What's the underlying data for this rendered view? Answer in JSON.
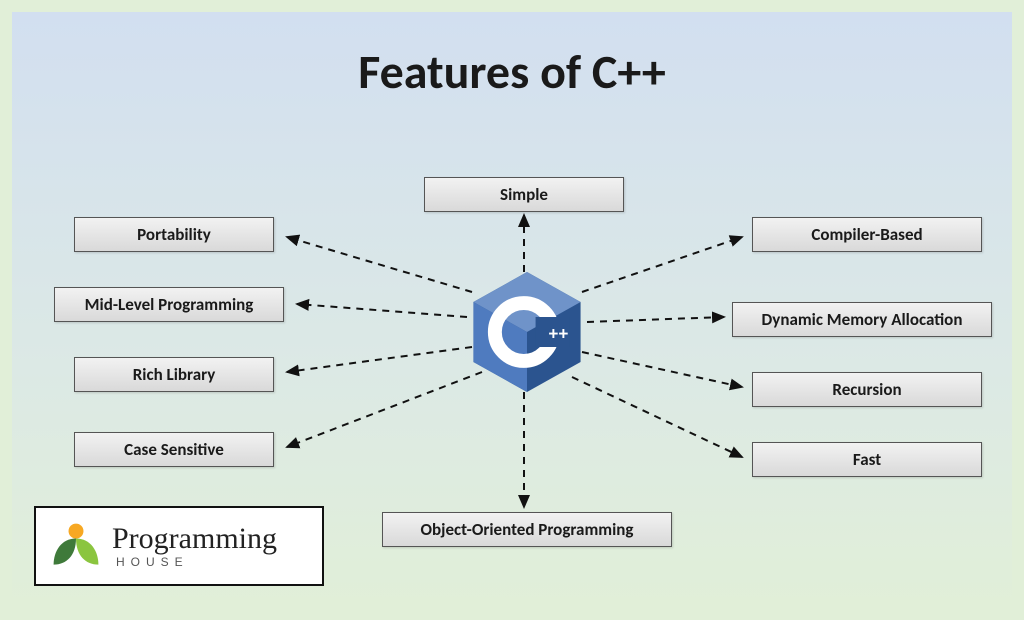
{
  "title": "Features of C++",
  "center": {
    "logo_label": "C++",
    "logo_name": "cpp-logo"
  },
  "features": {
    "simple": "Simple",
    "portability": "Portability",
    "midlevel": "Mid-Level Programming",
    "richlib": "Rich Library",
    "casesens": "Case Sensitive",
    "compiler": "Compiler-Based",
    "dynmem": "Dynamic Memory Allocation",
    "recursion": "Recursion",
    "fast": "Fast",
    "oop": "Object-Oriented Programming"
  },
  "brand": {
    "name": "Programming",
    "sub": "HOUSE"
  },
  "colors": {
    "box_border": "#555555",
    "title": "#1a1a1a",
    "logo_top": "#6f93c9",
    "logo_left": "#4f7bbf",
    "logo_right": "#2b548f",
    "brand_green": "#8bc53f",
    "brand_orange": "#f7a823"
  }
}
